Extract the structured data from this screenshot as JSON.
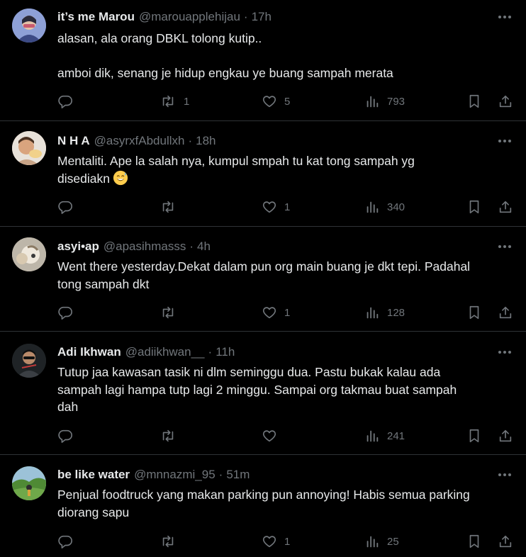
{
  "tweets": [
    {
      "name": "it’s me Marou",
      "handle": "@marouapplehijau",
      "dot": "·",
      "time": "17h",
      "lines": [
        "alasan, ala orang DBKL tolong kutip..",
        "",
        "amboi dik, senang je hidup engkau ye buang sampah merata"
      ],
      "replies": "",
      "retweets": "1",
      "likes": "5",
      "views": "793",
      "avatar_color": "#6e7fb8"
    },
    {
      "name": "N H A",
      "handle": "@asyrxfAbdullxh",
      "dot": "·",
      "time": "18h",
      "lines": [
        "Mentaliti. Ape la salah nya, kumpul smpah tu kat tong sampah yg",
        "disediakn"
      ],
      "emoji": "grinning-sweat-emoji",
      "replies": "",
      "retweets": "",
      "likes": "1",
      "views": "340",
      "avatar_color": "#d9b79a"
    },
    {
      "name": "asyi•ap",
      "handle": "@apasihmasss",
      "dot": "·",
      "time": "4h",
      "lines": [
        "Went there yesterday.Dekat dalam pun org main buang je dkt tepi. Padahal",
        "tong sampah dkt"
      ],
      "replies": "",
      "retweets": "",
      "likes": "1",
      "views": "128",
      "avatar_color": "#cfc7b8"
    },
    {
      "name": "Adi Ikhwan",
      "handle": "@adiikhwan__",
      "dot": "·",
      "time": "11h",
      "lines": [
        "Tutup jaa kawasan tasik ni dlm seminggu dua. Pastu bukak kalau ada",
        "sampah lagi hampa tutp lagi 2 minggu. Sampai org takmau buat sampah",
        "dah"
      ],
      "replies": "",
      "retweets": "",
      "likes": "",
      "views": "241",
      "avatar_color": "#2b2b2b"
    },
    {
      "name": "be like water",
      "handle": "@mnnazmi_95",
      "dot": "·",
      "time": "51m",
      "lines": [
        "Penjual foodtruck yang makan parking pun annoying! Habis semua parking",
        "diorang sapu"
      ],
      "replies": "",
      "retweets": "",
      "likes": "1",
      "views": "25",
      "avatar_color": "#5f8f3e"
    }
  ],
  "colors": {
    "background": "#000000",
    "text": "#e7e9ea",
    "muted": "#71767b",
    "divider": "#2f3336"
  },
  "icons": [
    "reply-icon",
    "retweet-icon",
    "like-icon",
    "views-icon",
    "bookmark-icon",
    "share-icon",
    "more-icon"
  ]
}
